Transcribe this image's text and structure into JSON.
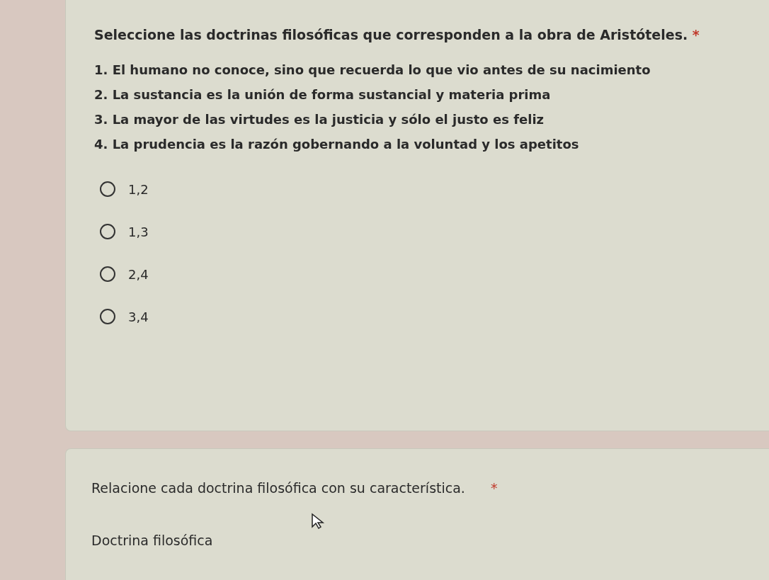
{
  "questions": [
    {
      "title": "Seleccione las doctrinas filosóficas que corresponden a la obra de Aristóteles.",
      "required_mark": "*",
      "statements": [
        "1. El humano no conoce, sino que recuerda lo que vio antes de su nacimiento",
        "2. La sustancia es la unión de forma sustancial y materia prima",
        "3. La mayor de las virtudes es la justicia y sólo el justo es feliz",
        "4. La prudencia es la razón gobernando a la voluntad y los apetitos"
      ],
      "options": [
        {
          "label": "1,2",
          "selected": false
        },
        {
          "label": "1,3",
          "selected": false
        },
        {
          "label": "2,4",
          "selected": false
        },
        {
          "label": "3,4",
          "selected": false
        }
      ]
    },
    {
      "title": "Relacione cada doctrina filosófica con su característica.",
      "required_mark": "*",
      "subheading": "Doctrina filosófica"
    }
  ]
}
